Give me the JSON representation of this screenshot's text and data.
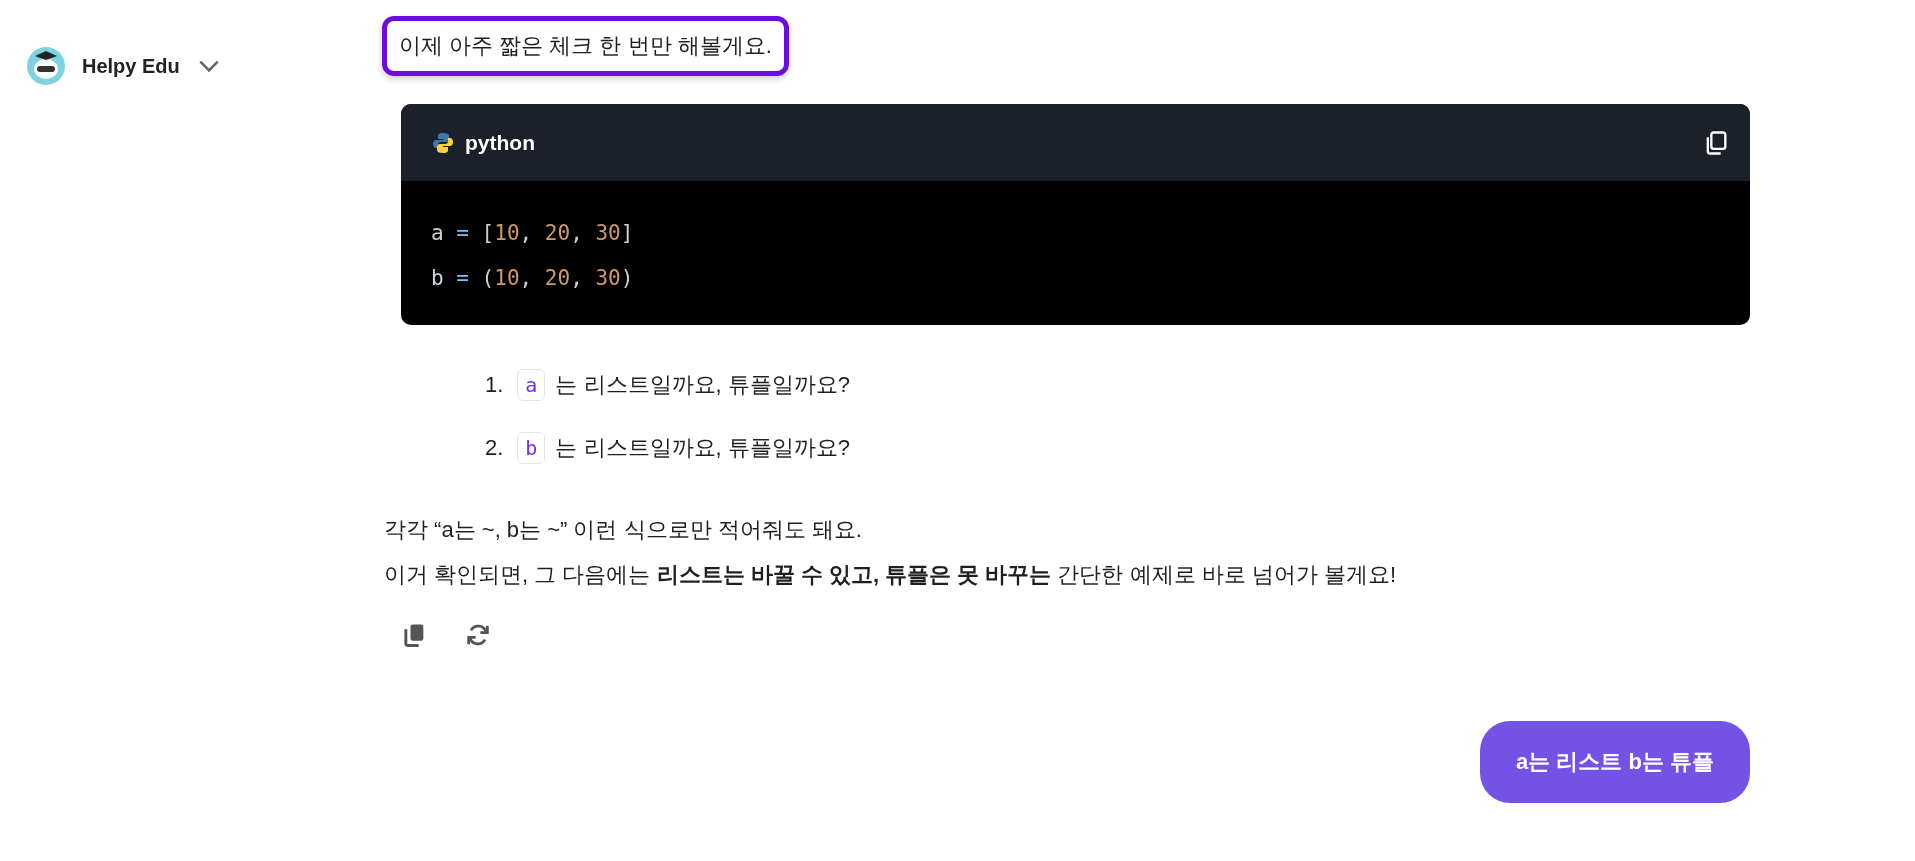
{
  "brand": {
    "name": "Helpy Edu"
  },
  "highlighted_message": "이제 아주 짧은 체크 한 번만 해볼게요.",
  "code_block": {
    "language": "python",
    "lines": [
      [
        {
          "kind": "ident",
          "text": "a"
        },
        {
          "kind": "op",
          "text": " = "
        },
        {
          "kind": "punct",
          "text": "["
        },
        {
          "kind": "number",
          "text": "10"
        },
        {
          "kind": "punct",
          "text": ", "
        },
        {
          "kind": "number",
          "text": "20"
        },
        {
          "kind": "punct",
          "text": ", "
        },
        {
          "kind": "number",
          "text": "30"
        },
        {
          "kind": "punct",
          "text": "]"
        }
      ],
      [
        {
          "kind": "ident",
          "text": "b"
        },
        {
          "kind": "op",
          "text": " = "
        },
        {
          "kind": "punct",
          "text": "("
        },
        {
          "kind": "number",
          "text": "10"
        },
        {
          "kind": "punct",
          "text": ", "
        },
        {
          "kind": "number",
          "text": "20"
        },
        {
          "kind": "punct",
          "text": ", "
        },
        {
          "kind": "number",
          "text": "30"
        },
        {
          "kind": "punct",
          "text": ")"
        }
      ]
    ]
  },
  "list": [
    {
      "number": "1.",
      "code": "a",
      "text": "는 리스트일까요, 튜플일까요?"
    },
    {
      "number": "2.",
      "code": "b",
      "text": "는 리스트일까요, 튜플일까요?"
    }
  ],
  "paragraphs": [
    "각각 “a는 ~, b는 ~” 이런 식으로만 적어줘도 돼요.",
    "이거 확인되면, 그 다음에는 **리스트는 바꿀 수 있고, 튜플은 못 바꾸는** 간단한 예제로 바로 넘어가 볼게요!"
  ],
  "user_message": "a는 리스트 b는 튜플"
}
